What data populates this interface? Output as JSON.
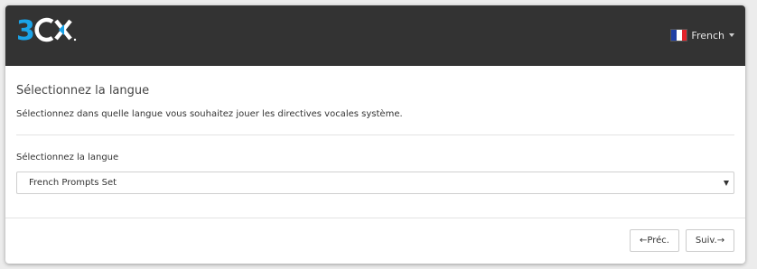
{
  "header": {
    "logo_text": "3CX",
    "language_label": "French",
    "flag_colors": [
      "#1f3fa3",
      "#ffffff",
      "#e2232a"
    ]
  },
  "main": {
    "title": "Sélectionnez la langue",
    "description": "Sélectionnez dans quelle langue vous souhaitez jouer les directives vocales système.",
    "field_label": "Sélectionnez la langue",
    "select_value": "French Prompts Set"
  },
  "footer": {
    "prev_label": "←Préc.",
    "next_label": "Suiv.→"
  },
  "colors": {
    "header_bg": "#333333",
    "logo_blue": "#1aa3e8",
    "logo_white": "#ffffff"
  }
}
